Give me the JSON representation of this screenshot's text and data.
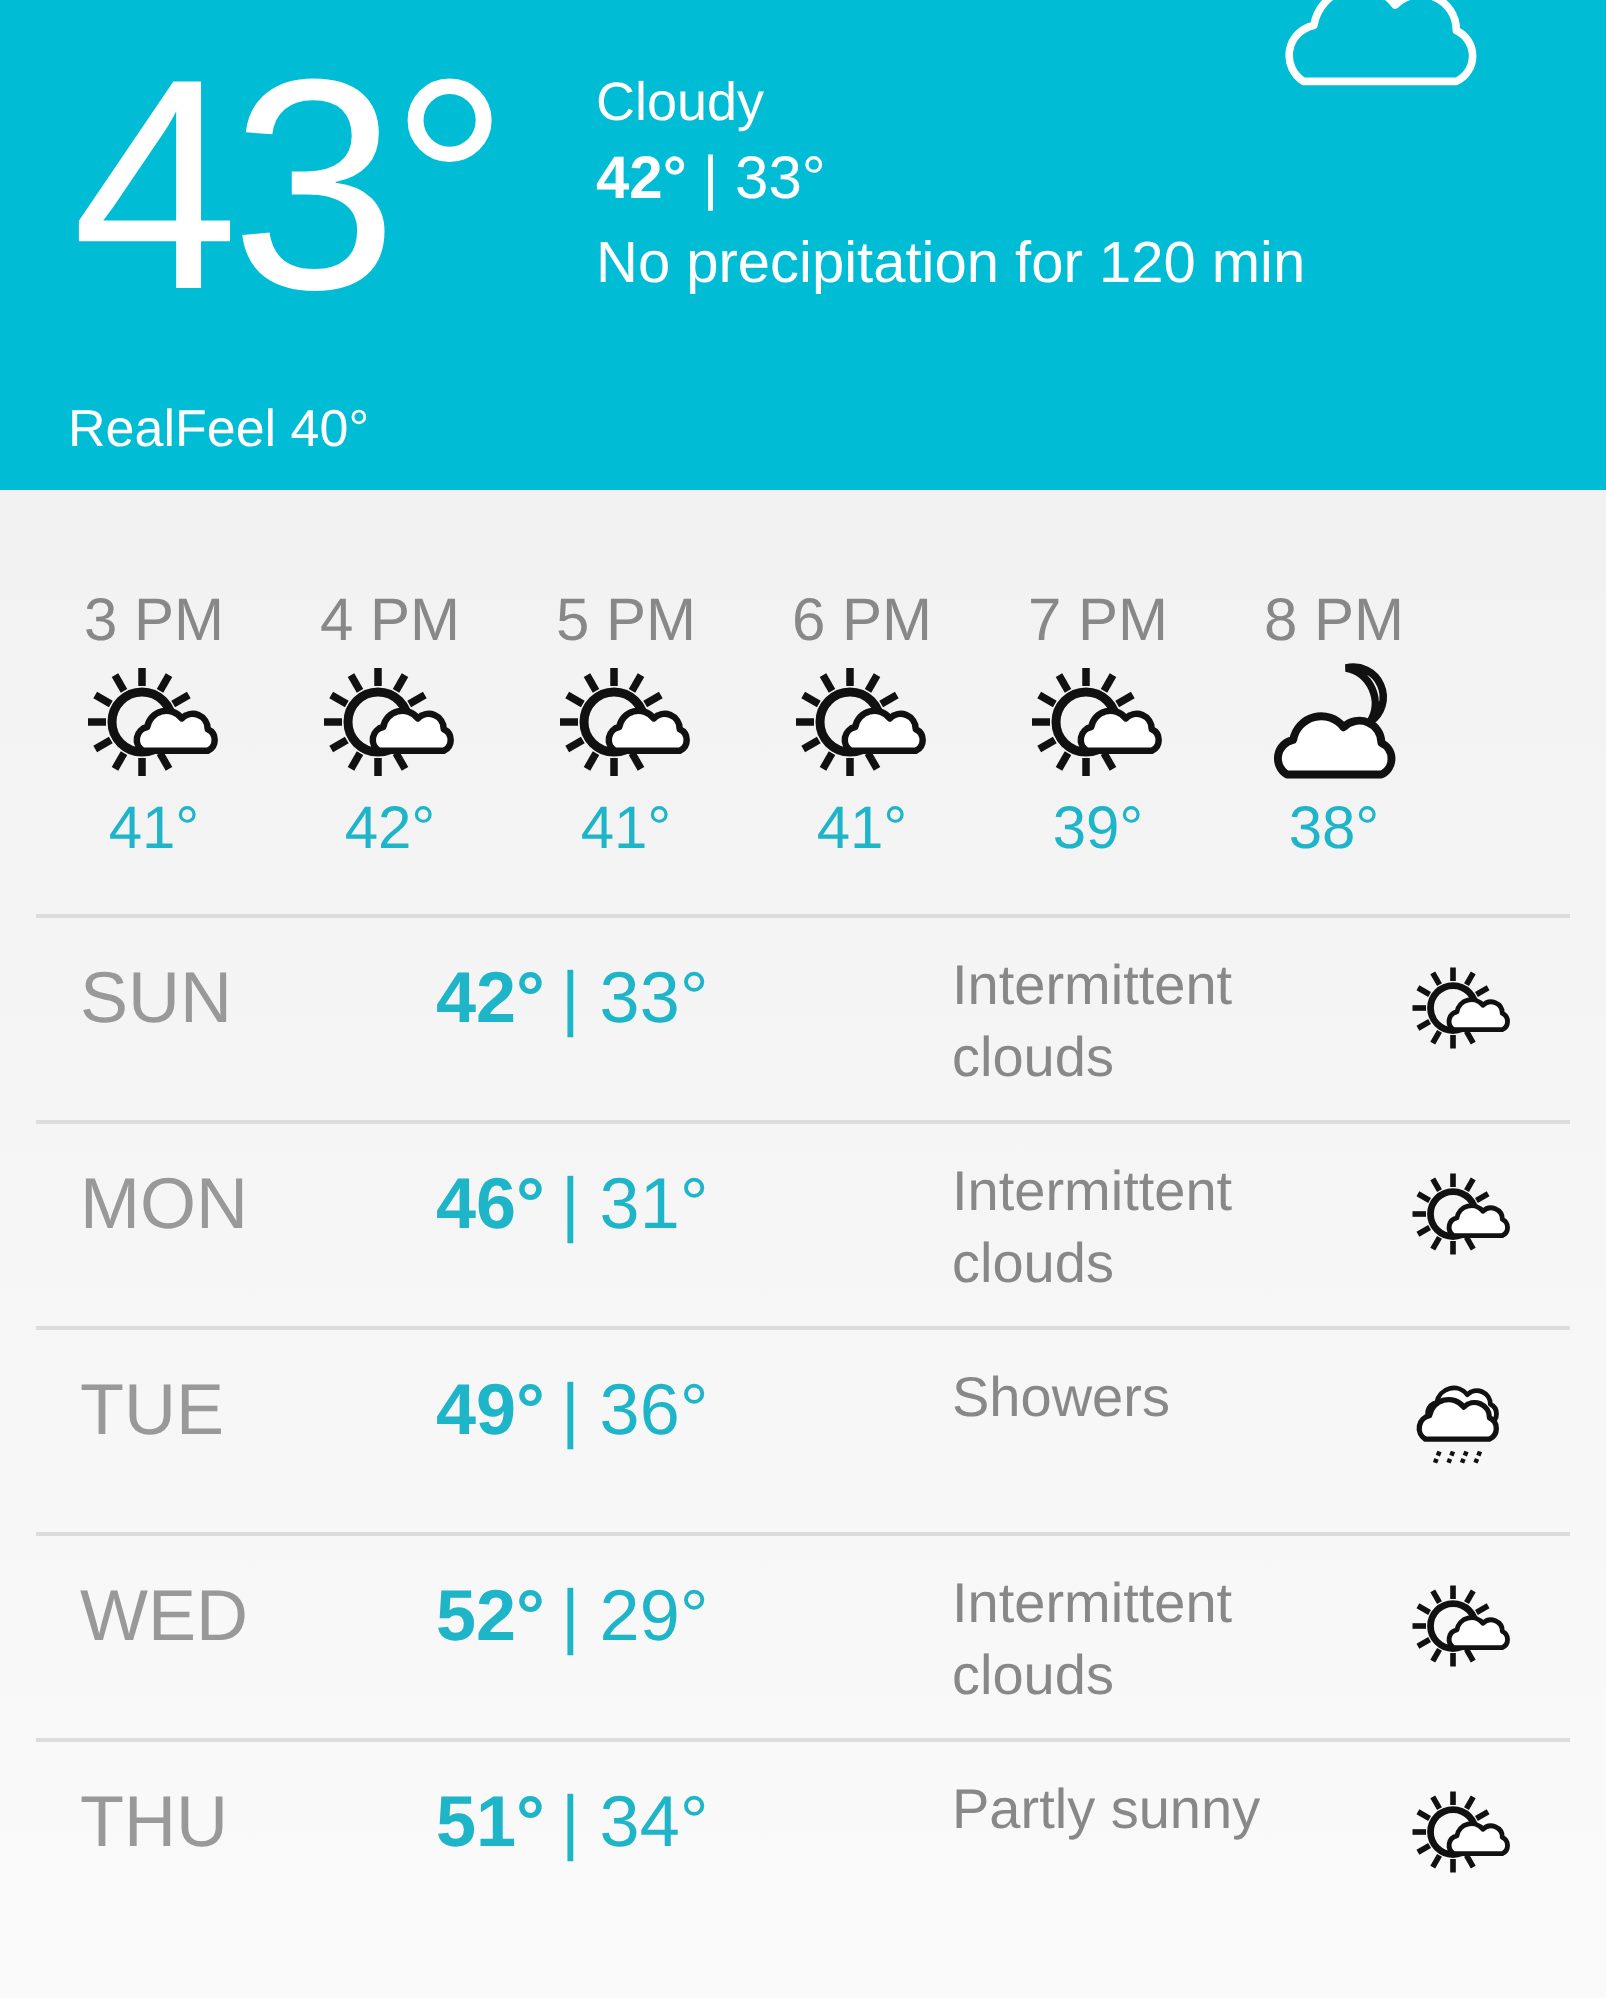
{
  "current": {
    "temperature": "43°",
    "condition": "Cloudy",
    "high": "42°",
    "low": "| 33°",
    "precipitation": "No precipitation for 120 min",
    "realfeel": "RealFeel 40°"
  },
  "hourly": [
    {
      "time": "3 PM",
      "kind": "sun-cloud",
      "temperature": "41°"
    },
    {
      "time": "4 PM",
      "kind": "sun-cloud",
      "temperature": "42°"
    },
    {
      "time": "5 PM",
      "kind": "sun-cloud",
      "temperature": "41°"
    },
    {
      "time": "6 PM",
      "kind": "sun-cloud",
      "temperature": "41°"
    },
    {
      "time": "7 PM",
      "kind": "sun-cloud",
      "temperature": "39°"
    },
    {
      "time": "8 PM",
      "kind": "moon-cloud",
      "temperature": "38°"
    }
  ],
  "daily": [
    {
      "day": "SUN",
      "high": "42°",
      "low": "| 33°",
      "condition": "Intermittent clouds",
      "kind": "sun-cloud"
    },
    {
      "day": "MON",
      "high": "46°",
      "low": "| 31°",
      "condition": "Intermittent clouds",
      "kind": "sun-cloud"
    },
    {
      "day": "TUE",
      "high": "49°",
      "low": "| 36°",
      "condition": "Showers",
      "kind": "rain-cloud"
    },
    {
      "day": "WED",
      "high": "52°",
      "low": "| 29°",
      "condition": "Intermittent clouds",
      "kind": "sun-cloud"
    },
    {
      "day": "THU",
      "high": "51°",
      "low": "| 34°",
      "condition": "Partly sunny",
      "kind": "sun-cloud"
    }
  ]
}
